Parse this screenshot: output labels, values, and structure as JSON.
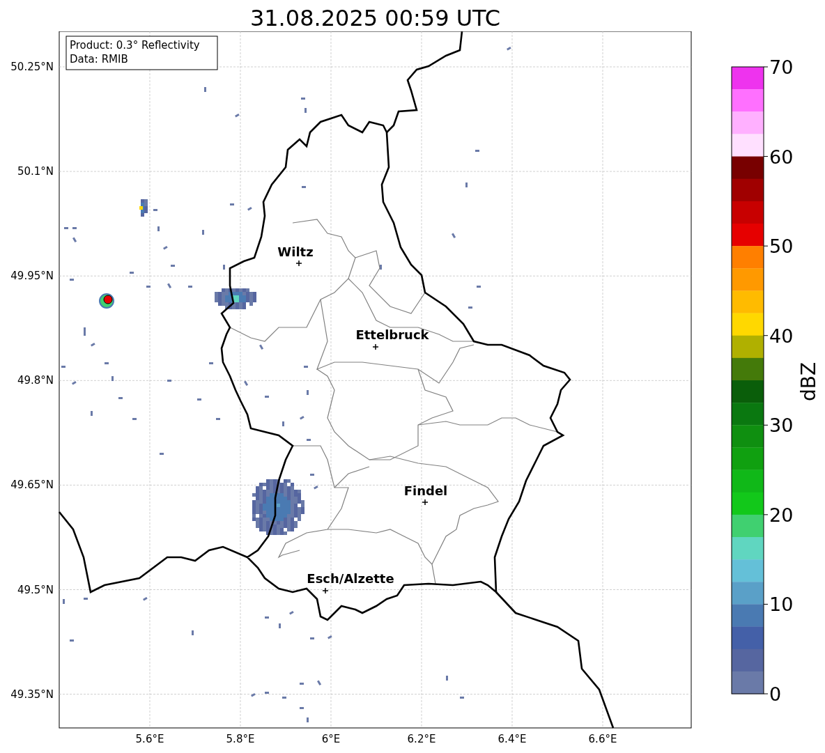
{
  "title": "31.08.2025 00:59 UTC",
  "legend": [
    "Product: 0.3° Reflectivity",
    "Data: RMIB"
  ],
  "lat_ticks": [
    "50.25°N",
    "50.1°N",
    "49.95°N",
    "49.8°N",
    "49.65°N",
    "49.5°N",
    "49.35°N"
  ],
  "lon_ticks": [
    "5.6°E",
    "5.8°E",
    "6°E",
    "6.2°E",
    "6.4°E",
    "6.6°E"
  ],
  "cities": [
    {
      "name": "Wiltz"
    },
    {
      "name": "Ettelbruck"
    },
    {
      "name": "Findel"
    },
    {
      "name": "Esch/Alzette"
    }
  ],
  "colorbar": {
    "label": "dBZ",
    "ticks": [
      "70",
      "60",
      "50",
      "40",
      "30",
      "20",
      "10",
      "0"
    ],
    "segments": [
      {
        "color": "#ee33ee"
      },
      {
        "color": "#ff70ff"
      },
      {
        "color": "#ffb0ff"
      },
      {
        "color": "#ffe0ff"
      },
      {
        "color": "#780000"
      },
      {
        "color": "#a00000"
      },
      {
        "color": "#c80000"
      },
      {
        "color": "#e60000"
      },
      {
        "color": "#ff7f00"
      },
      {
        "color": "#ff9900"
      },
      {
        "color": "#ffbb00"
      },
      {
        "color": "#ffd800"
      },
      {
        "color": "#b0b000"
      },
      {
        "color": "#447a0a"
      },
      {
        "color": "#0a5e0a"
      },
      {
        "color": "#0a7810"
      },
      {
        "color": "#0f8f10"
      },
      {
        "color": "#10a010"
      },
      {
        "color": "#10b818"
      },
      {
        "color": "#12c81a"
      },
      {
        "color": "#40d070"
      },
      {
        "color": "#60d6c0"
      },
      {
        "color": "#64c0d8"
      },
      {
        "color": "#5aa0c8"
      },
      {
        "color": "#4a7ab2"
      },
      {
        "color": "#4460a8"
      },
      {
        "color": "#5666a0"
      },
      {
        "color": "#6a7aa8"
      }
    ]
  }
}
